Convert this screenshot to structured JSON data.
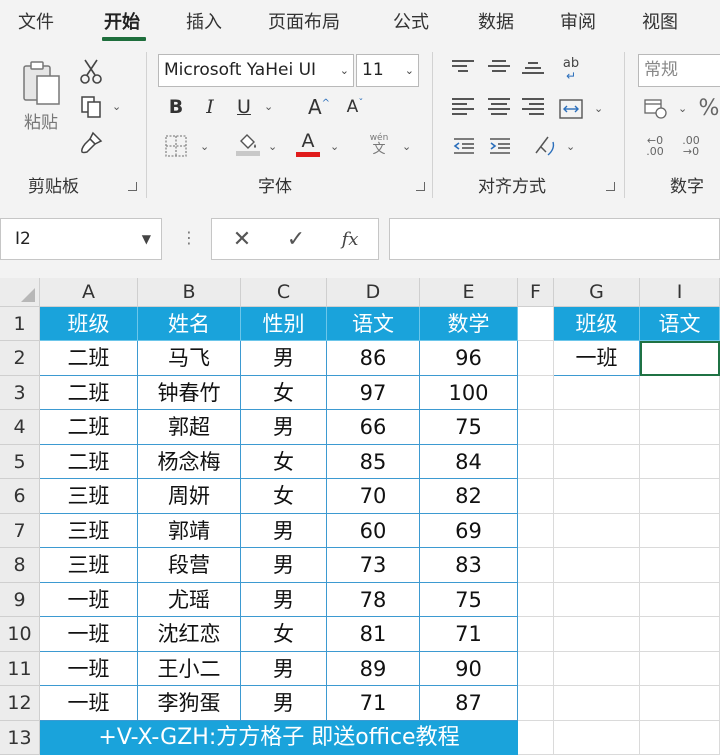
{
  "menu": {
    "items": [
      {
        "label": "文件"
      },
      {
        "label": "开始"
      },
      {
        "label": "插入"
      },
      {
        "label": "页面布局"
      },
      {
        "label": "公式"
      },
      {
        "label": "数据"
      },
      {
        "label": "审阅"
      },
      {
        "label": "视图"
      }
    ],
    "active_index": 1
  },
  "ribbon": {
    "clipboard": {
      "label": "剪贴板",
      "paste_label": "粘贴"
    },
    "font": {
      "label": "字体",
      "font_name": "Microsoft YaHei UI",
      "font_size": "11",
      "bold": "B",
      "italic": "I",
      "underline": "U",
      "grow": "A",
      "shrink": "A",
      "font_color_letter": "A",
      "phonetic_top": "wén",
      "phonetic_bottom": "文",
      "fill_color": "#c8c8c8",
      "font_color": "#e01b1b"
    },
    "alignment": {
      "label": "对齐方式",
      "wrap_glyph": "ab"
    },
    "number": {
      "label": "数字",
      "format": "常规"
    }
  },
  "formula_bar": {
    "name_box": "I2",
    "cancel": "✕",
    "enter": "✓",
    "fx": "fx",
    "content": ""
  },
  "sheet": {
    "columns": [
      "A",
      "B",
      "C",
      "D",
      "E",
      "F",
      "G",
      "I"
    ],
    "rows": [
      "1",
      "2",
      "3",
      "4",
      "5",
      "6",
      "7",
      "8",
      "9",
      "10",
      "11",
      "12",
      "13"
    ],
    "header_color": "#1aa3db",
    "table": {
      "headers": [
        "班级",
        "姓名",
        "性别",
        "语文",
        "数学"
      ],
      "rows": [
        [
          "二班",
          "马飞",
          "男",
          "86",
          "96"
        ],
        [
          "二班",
          "钟春竹",
          "女",
          "97",
          "100"
        ],
        [
          "二班",
          "郭超",
          "男",
          "66",
          "75"
        ],
        [
          "二班",
          "杨念梅",
          "女",
          "85",
          "84"
        ],
        [
          "三班",
          "周妍",
          "女",
          "70",
          "82"
        ],
        [
          "三班",
          "郭靖",
          "男",
          "60",
          "69"
        ],
        [
          "三班",
          "段营",
          "男",
          "73",
          "83"
        ],
        [
          "一班",
          "尤瑶",
          "男",
          "78",
          "75"
        ],
        [
          "一班",
          "沈红恋",
          "女",
          "81",
          "71"
        ],
        [
          "一班",
          "王小二",
          "男",
          "89",
          "90"
        ],
        [
          "一班",
          "李狗蛋",
          "男",
          "71",
          "87"
        ]
      ]
    },
    "criteria": {
      "headers": [
        "班级",
        "语文"
      ],
      "values": [
        "一班",
        ""
      ]
    },
    "banner": "+V-X-GZH:方方格子 即送office教程"
  }
}
